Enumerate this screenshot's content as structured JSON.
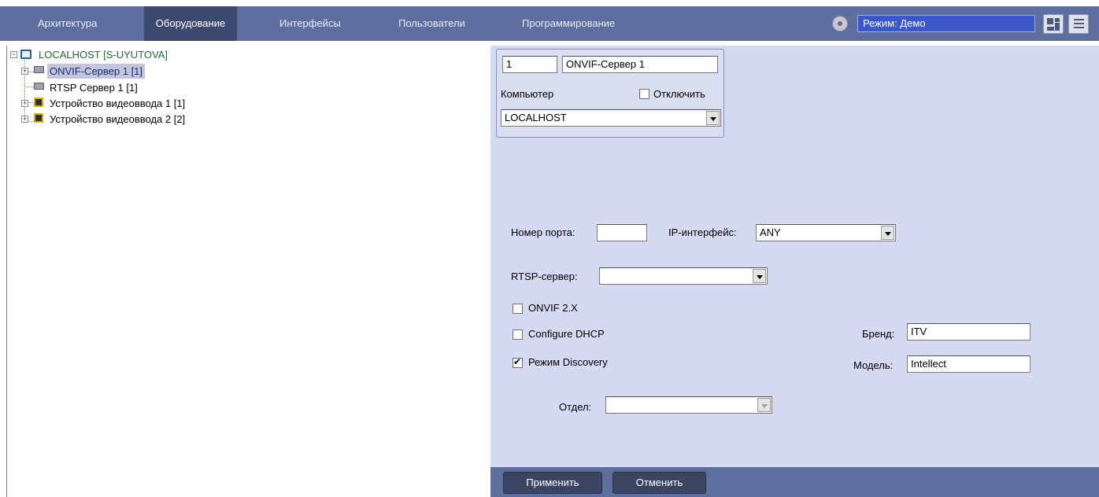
{
  "tabs": [
    {
      "label": "Архитектура",
      "active": false
    },
    {
      "label": "Оборудование",
      "active": true
    },
    {
      "label": "Интерфейсы",
      "active": false
    },
    {
      "label": "Пользователи",
      "active": false
    },
    {
      "label": "Программирование",
      "active": false
    }
  ],
  "mode": {
    "label": "Режим: Демо",
    "icon": "mode-gear-icon"
  },
  "toolbar": {
    "layout_icon": "layout-grid-icon",
    "menu_icon": "menu-lines-icon"
  },
  "tree": {
    "root": "LOCALHOST [S-UYUTOVA]",
    "items": [
      {
        "label": "ONVIF-Сервер 1 [1]",
        "icon": "server-icon",
        "selected": true
      },
      {
        "label": "RTSP Сервер 1 [1]",
        "icon": "server-icon",
        "selected": false
      },
      {
        "label": "Устройство видеоввода 1 [1]",
        "icon": "chip-icon",
        "selected": false
      },
      {
        "label": "Устройство видеоввода 2 [2]",
        "icon": "chip-icon",
        "selected": false
      }
    ]
  },
  "object": {
    "id": "1",
    "name": "ONVIF-Сервер 1",
    "computer_label": "Компьютер",
    "disable_label": "Отключить",
    "disable_checked": false,
    "computer_value": "LOCALHOST"
  },
  "settings": {
    "port_label": "Номер порта:",
    "port_value": "",
    "ip_label": "IP-интерфейс:",
    "ip_value": "ANY",
    "rtsp_label": "RTSP-сервер:",
    "rtsp_value": "",
    "onvif2x_label": "ONVIF 2.X",
    "onvif2x_checked": false,
    "dhcp_label": "Configure DHCP",
    "dhcp_checked": false,
    "discovery_label": "Режим Discovery",
    "discovery_checked": true,
    "brand_label": "Бренд:",
    "brand_value": "ITV",
    "model_label": "Модель:",
    "model_value": "Intellect",
    "dept_label": "Отдел:",
    "dept_value": ""
  },
  "footer": {
    "apply_label": "Применить",
    "cancel_label": "Отменить"
  },
  "colors": {
    "tabbar": "#5d6f9e",
    "active_tab": "#3d4a6f",
    "panel": "#d5d9f1",
    "mode_box": "#3c58c8"
  }
}
